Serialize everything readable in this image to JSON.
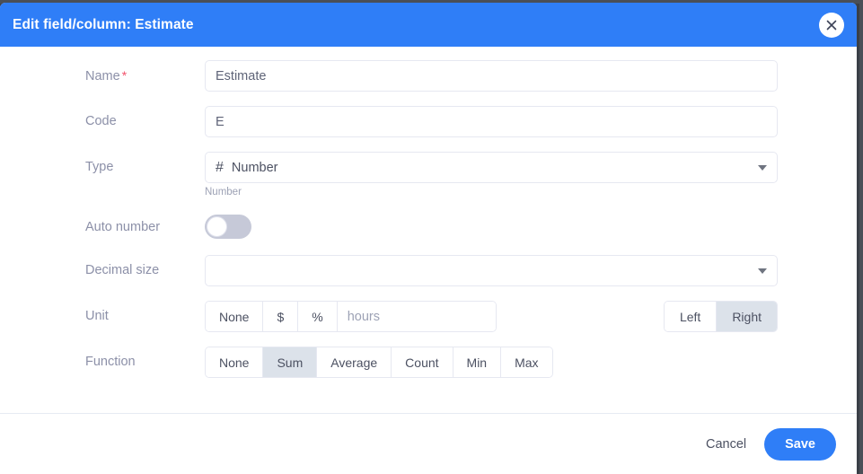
{
  "dialog": {
    "title": "Edit field/column: Estimate",
    "close_icon": "close-icon",
    "header_color": "#2f7ef7"
  },
  "fields": {
    "name": {
      "label": "Name",
      "required_marker": "*",
      "value": "Estimate",
      "placeholder": ""
    },
    "code": {
      "label": "Code",
      "value": "E",
      "placeholder": ""
    },
    "type": {
      "label": "Type",
      "icon": "hash-icon",
      "icon_glyph": "#",
      "value": "Number",
      "helper": "Number"
    },
    "auto_number": {
      "label": "Auto number",
      "state": "off"
    },
    "decimal_size": {
      "label": "Decimal size",
      "value": "",
      "placeholder": ""
    },
    "unit": {
      "label": "Unit",
      "options": [
        "None",
        "$",
        "%"
      ],
      "selected": "",
      "custom_value": "hours",
      "custom_placeholder": "hours",
      "alignment_options": [
        "Left",
        "Right"
      ],
      "alignment_selected": "Right"
    },
    "function": {
      "label": "Function",
      "options": [
        "None",
        "Sum",
        "Average",
        "Count",
        "Min",
        "Max"
      ],
      "selected": "Sum"
    }
  },
  "footer": {
    "cancel_label": "Cancel",
    "save_label": "Save",
    "save_color": "#2f7ef7"
  }
}
